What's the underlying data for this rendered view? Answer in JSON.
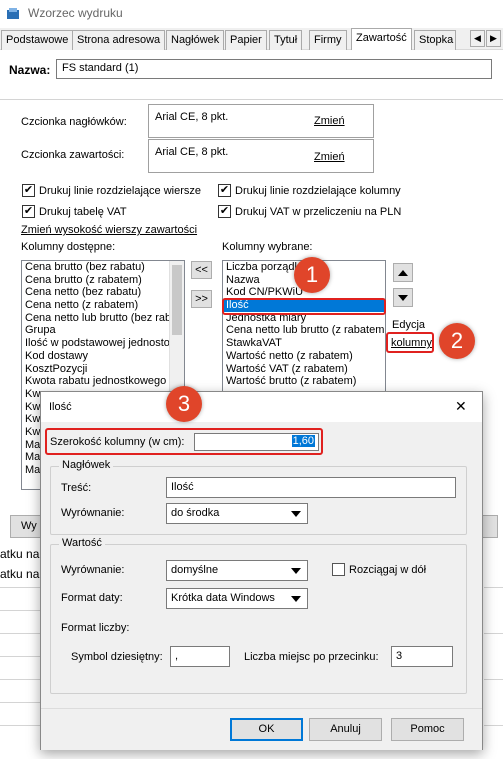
{
  "window": {
    "title": "Wzorzec wydruku"
  },
  "tabs": [
    "Podstawowe",
    "Strona adresowa",
    "Nagłówek",
    "Papier",
    "Tytuł",
    "Firmy",
    "Zawartość",
    "Stopka"
  ],
  "tab_nav": {
    "left": "◀",
    "right": "▶"
  },
  "name": {
    "label": "Nazwa:",
    "value": "FS standard (1)"
  },
  "fonts": {
    "header_label": "Czcionka nagłówków:",
    "header_value": "Arial CE, 8 pkt.",
    "content_label": "Czcionka zawartości:",
    "content_value": "Arial CE, 8 pkt.",
    "change": "Zmień"
  },
  "options": {
    "row_lines": "Drukuj linie rozdzielające wiersze",
    "col_lines": "Drukuj linie rozdzielające kolumny",
    "vat_table": "Drukuj tabelę VAT",
    "vat_pln": "Drukuj VAT w przeliczeniu na PLN",
    "check": "✔"
  },
  "row_height_link": "Zmień wysokość wierszy zawartości",
  "available": {
    "label": "Kolumny dostępne:",
    "items": [
      "Cena brutto (bez rabatu)",
      "Cena brutto (z rabatem)",
      "Cena netto (bez rabatu)",
      "Cena netto (z rabatem)",
      "Cena netto lub brutto (bez rab",
      "Grupa",
      "Ilość w podstawowej jednosto",
      "Kod dostawy",
      "KosztPozycji",
      "Kwota rabatu jednostkowego",
      "Kw",
      "Kw",
      "Kw",
      "Kw",
      "Ma",
      "Ma",
      "Ma"
    ]
  },
  "move_buttons": {
    "left": "<<",
    "right": ">>"
  },
  "selected": {
    "label": "Kolumny wybrane:",
    "items": [
      "Liczba porządkowa",
      "Nazwa",
      "Kod CN/PKWiU",
      "Ilość",
      "Jednostka miary",
      "Cena netto lub brutto (z rabatem",
      "StawkaVAT",
      "Wartość netto (z rabatem)",
      "Wartość VAT (z rabatem)",
      "Wartość brutto (z rabatem)"
    ]
  },
  "edit": {
    "label": "Edycja",
    "button": "kolumny"
  },
  "callouts": [
    "1",
    "2",
    "3"
  ],
  "bg": {
    "btn_partial": "Wy",
    "row1": "atku na",
    "row2": "atku na"
  },
  "dialog": {
    "title": "Ilość",
    "close": "✕",
    "width_label": "Szerokość kolumny (w cm):",
    "width_value": "1,60",
    "header_group": {
      "title": "Nagłówek",
      "content_label": "Treść:",
      "content_value": "Ilość",
      "align_label": "Wyrównanie:",
      "align_value": "do środka"
    },
    "value_group": {
      "title": "Wartość",
      "align_label": "Wyrównanie:",
      "align_value": "domyślne",
      "stretch_label": "Rozciągaj w dół",
      "date_label": "Format daty:",
      "date_value": "Krótka data Windows",
      "number_label": "Format liczby:",
      "decimal_label": "Symbol dziesiętny:",
      "decimal_value": ",",
      "places_label": "Liczba miejsc po przecinku:",
      "places_value": "3"
    },
    "buttons": {
      "ok": "OK",
      "cancel": "Anuluj",
      "help": "Pomoc"
    }
  },
  "colors": {
    "accent": "#0078d7",
    "callout": "#e0452a",
    "highlight": "#e0211f"
  }
}
